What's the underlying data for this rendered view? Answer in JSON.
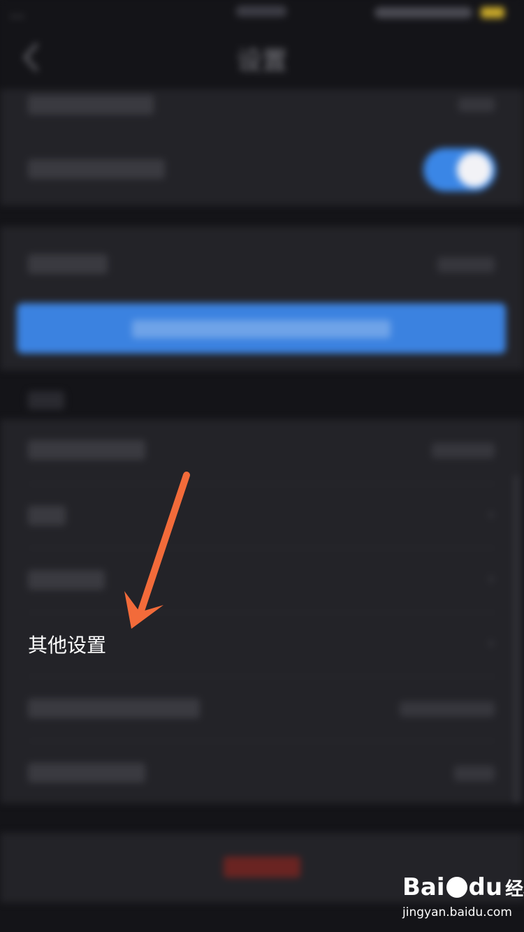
{
  "status_bar": {
    "carrier": "..."
  },
  "nav": {
    "title": "设置"
  },
  "focused_item": {
    "label": "其他设置"
  },
  "watermark": {
    "logo_text": "Bai",
    "logo_text_2": "du",
    "logo_suffix": "经验",
    "url": "jingyan.baidu.com"
  },
  "colors": {
    "background": "#141418",
    "section": "#232328",
    "accent_blue": "#3b82e0",
    "annotation_arrow": "#f26b3a",
    "logout_red": "#b0302c"
  },
  "icons": {
    "back": "chevron-left-icon",
    "annotation": "arrow-icon"
  }
}
